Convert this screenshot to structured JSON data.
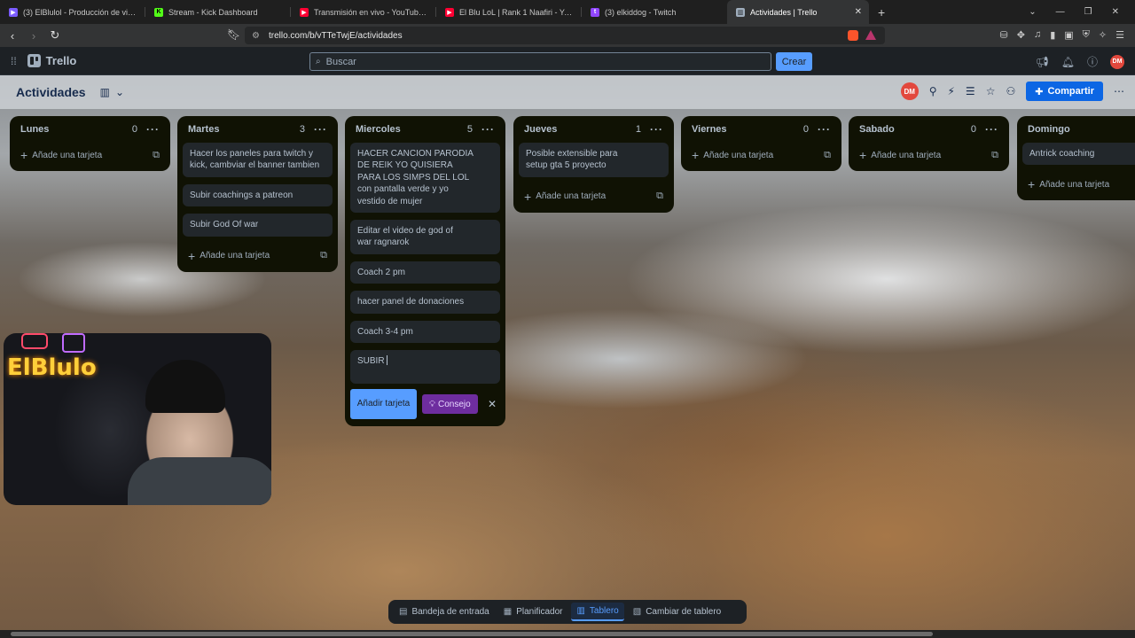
{
  "browser": {
    "tabs": [
      {
        "label": "(3) ElBlulol - Producción de video - Tu",
        "color": "#7b5cff",
        "glyph": "▶"
      },
      {
        "label": "Stream - Kick Dashboard",
        "color": "#53fc18",
        "glyph": "K"
      },
      {
        "label": "Transmisión en vivo - YouTube Studio",
        "color": "#ff0033",
        "glyph": "▶"
      },
      {
        "label": "El Blu LoL | Rank 1 Naafiri - YouTube",
        "color": "#ff0033",
        "glyph": "▶"
      },
      {
        "label": "(3) elkiddog - Twitch",
        "color": "#9146ff",
        "glyph": "t"
      },
      {
        "label": "Actividades | Trello",
        "color": "#9fadbc",
        "glyph": "▥"
      }
    ],
    "url": "trello.com/b/vTTeTwjE/actividades"
  },
  "header": {
    "logo": "Trello",
    "search_placeholder": "Buscar",
    "create_label": "Crear",
    "user_initials": "DM"
  },
  "board": {
    "title": "Actividades",
    "share_label": "Compartir",
    "member_initials": "DM"
  },
  "lists": {
    "lunes": {
      "name": "Lunes",
      "count": "0",
      "add": "Añade una tarjeta"
    },
    "martes": {
      "name": "Martes",
      "count": "3",
      "add": "Añade una tarjeta",
      "cards": [
        "Hacer los paneles para twitch y kick, cambviar el banner tambien",
        "Subir coachings a patreon",
        "Subir God Of war"
      ]
    },
    "miercoles": {
      "name": "Miercoles",
      "count": "5",
      "cards": [
        "HACER CANCION PARODIA DE REIK YO QUISIERA PARA LOS SIMPS DEL LOL con pantalla verde y yo vestido de mujer",
        "Editar el video de god of war ragnarok",
        "Coach 2 pm",
        "hacer panel de donaciones",
        "Coach 3-4 pm"
      ],
      "composer_text": "SUBIR",
      "add_button": "Añadir tarjeta",
      "tip_button": "Consejo"
    },
    "jueves": {
      "name": "Jueves",
      "count": "1",
      "add": "Añade una tarjeta",
      "cards": [
        "Posible extensible para setup gta 5 proyecto"
      ]
    },
    "viernes": {
      "name": "Viernes",
      "count": "0",
      "add": "Añade una tarjeta"
    },
    "sabado": {
      "name": "Sabado",
      "count": "0",
      "add": "Añade una tarjeta"
    },
    "domingo": {
      "name": "Domingo",
      "add": "Añade una tarjeta",
      "cards": [
        "Antrick coaching"
      ]
    }
  },
  "overlay": {
    "channel_text": "ElBlulo"
  },
  "bottom_nav": {
    "inbox": "Bandeja de entrada",
    "planner": "Planificador",
    "board": "Tablero",
    "switch": "Cambiar de tablero"
  }
}
